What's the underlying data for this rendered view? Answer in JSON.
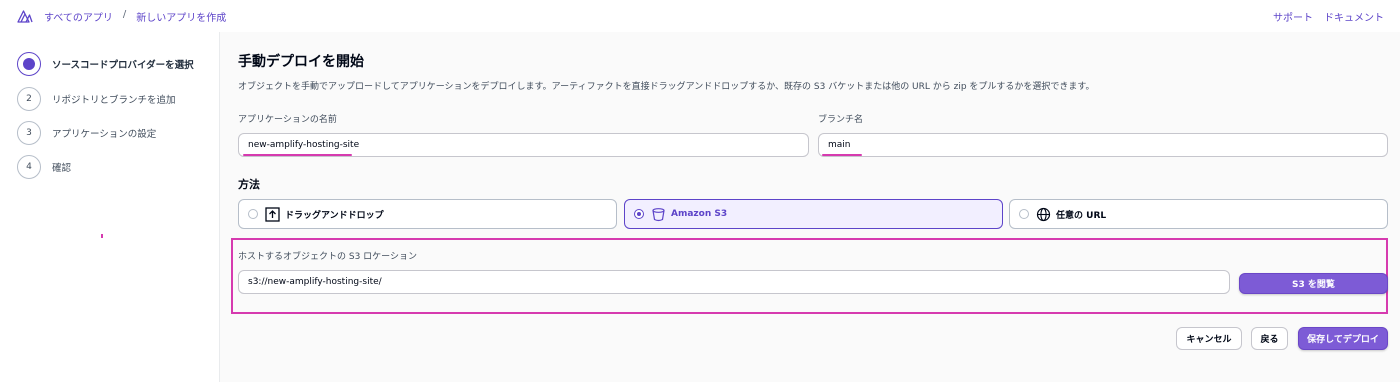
{
  "header": {
    "breadcrumbs": [
      "すべてのアプリ",
      "新しいアプリを作成"
    ],
    "separator": "/",
    "links": [
      "サポート",
      "ドキュメント"
    ]
  },
  "sidebar": {
    "steps": [
      {
        "number": "",
        "label": "ソースコードプロバイダーを選択",
        "state": "active"
      },
      {
        "number": "2",
        "label": "リポジトリとブランチを追加",
        "state": "pending"
      },
      {
        "number": "3",
        "label": "アプリケーションの設定",
        "state": "pending"
      },
      {
        "number": "4",
        "label": "確認",
        "state": "pending"
      }
    ]
  },
  "main": {
    "title": "手動デプロイを開始",
    "description": "オブジェクトを手動でアップロードしてアプリケーションをデプロイします。アーティファクトを直接ドラッグアンドドロップするか、既存の S3 バケットまたは他の URL から zip をプルするかを選択できます。",
    "app_name": {
      "label": "アプリケーションの名前",
      "value": "new-amplify-hosting-site"
    },
    "branch_name": {
      "label": "ブランチ名",
      "value": "main"
    },
    "method": {
      "title": "方法",
      "options": [
        {
          "label": "ドラッグアンドドロップ",
          "icon": "upload-icon",
          "selected": false
        },
        {
          "label": "Amazon S3",
          "icon": "bucket-icon",
          "selected": true
        },
        {
          "label": "任意の URL",
          "icon": "globe-icon",
          "selected": false
        }
      ]
    },
    "s3_location": {
      "label": "ホストするオブジェクトの S3 ロケーション",
      "value": "s3://new-amplify-hosting-site/",
      "browse_label": "S3 を閲覧"
    },
    "actions": {
      "cancel": "キャンセル",
      "back": "戻る",
      "save_deploy": "保存してデプロイ"
    }
  },
  "colors": {
    "accent": "#5d44c9",
    "button": "#7d5bd6",
    "annotation": "#d63aaf"
  }
}
